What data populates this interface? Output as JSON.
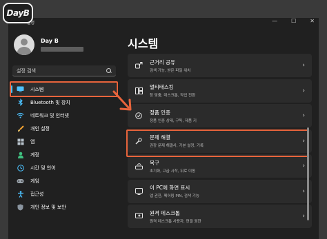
{
  "brand_logo": "DayB",
  "window": {
    "title": "설정",
    "controls": [
      "—",
      "☐",
      "✕"
    ]
  },
  "profile": {
    "name": "Day B"
  },
  "search": {
    "placeholder": "설정 검색"
  },
  "sidebar": {
    "items": [
      {
        "label": "시스템",
        "icon": "monitor-icon",
        "active": true
      },
      {
        "label": "Bluetooth 및 장치",
        "icon": "bluetooth-icon"
      },
      {
        "label": "네트워크 및 인터넷",
        "icon": "wifi-icon"
      },
      {
        "label": "개인 설정",
        "icon": "brush-icon"
      },
      {
        "label": "앱",
        "icon": "apps-icon"
      },
      {
        "label": "계정",
        "icon": "person-icon"
      },
      {
        "label": "시간 및 언어",
        "icon": "globe-clock-icon"
      },
      {
        "label": "게임",
        "icon": "gamepad-icon"
      },
      {
        "label": "접근성",
        "icon": "accessibility-icon"
      },
      {
        "label": "개인 정보 및 보안",
        "icon": "shield-icon"
      }
    ]
  },
  "main": {
    "title": "시스템",
    "cards": [
      {
        "title": "근거리 공유",
        "subtitle": "검색 가능, 받은 파일 위치",
        "icon": "share-icon"
      },
      {
        "title": "멀티태스킹",
        "subtitle": "창 맞춤, 데스크톱, 작업 전환",
        "icon": "multitask-icon"
      },
      {
        "title": "정품 인증",
        "subtitle": "정품 인증 상태, 구독, 제품 키",
        "icon": "check-circle-icon"
      },
      {
        "title": "문제 해결",
        "subtitle": "권장 문제 해결사, 기본 설정, 기록",
        "icon": "wrench-icon"
      },
      {
        "title": "복구",
        "subtitle": "초기화, 고급 시작, 뒤로 이동",
        "icon": "recovery-icon"
      },
      {
        "title": "이 PC에 화면 표시",
        "subtitle": "앱 권한, 페어링 PIN, 검색 기능",
        "icon": "project-icon"
      },
      {
        "title": "원격 데스크톱",
        "subtitle": "원격 데스크톱 사용자, 연결 권한",
        "icon": "remote-desktop-icon"
      }
    ]
  },
  "colors": {
    "highlight": "#e8643c",
    "accent": "#4cc2ff",
    "background": "#202020",
    "card": "#2b2b2b"
  }
}
